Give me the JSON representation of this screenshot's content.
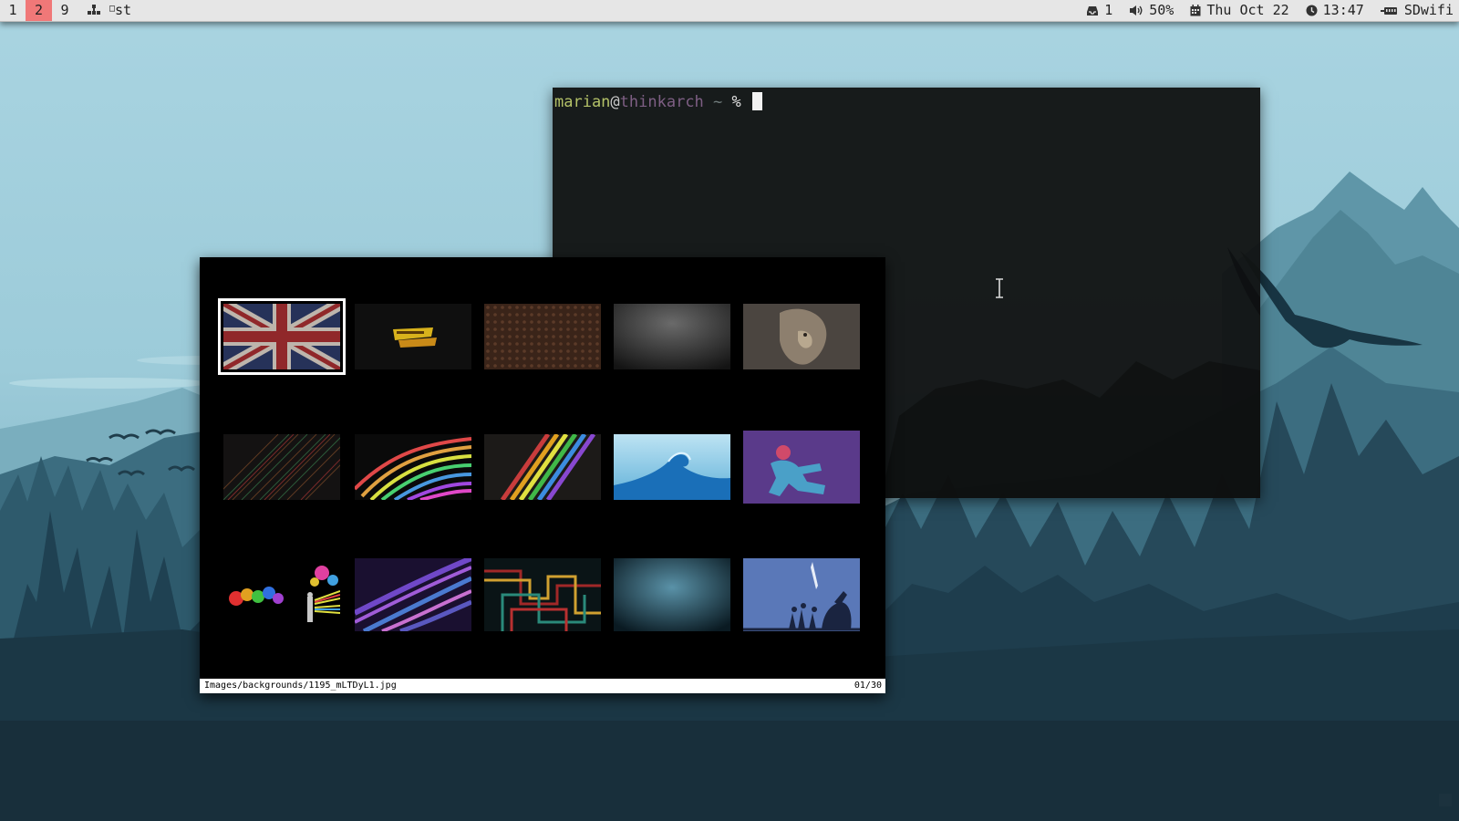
{
  "topbar": {
    "workspaces": [
      {
        "label": "1",
        "active": false
      },
      {
        "label": "2",
        "active": true
      },
      {
        "label": "9",
        "active": false
      }
    ],
    "active_color": "#f07878",
    "layout_icon": "layout-icon",
    "window_title": "st",
    "status": {
      "mail": {
        "icon": "inbox-icon",
        "value": "1"
      },
      "volume": {
        "icon": "speaker-icon",
        "value": "50%"
      },
      "date": {
        "icon": "calendar-icon",
        "value": "Thu Oct 22"
      },
      "time": {
        "icon": "clock-icon",
        "value": "13:47"
      },
      "network": {
        "icon": "ethernet-icon",
        "value": "SDwifi"
      }
    }
  },
  "terminal": {
    "user": "marian",
    "at": "@",
    "host": "thinkarch",
    "dir": " ~ ",
    "symbol": "% "
  },
  "viewer": {
    "path": "Images/backgrounds/1195_mLTDyL1.jpg",
    "counter": "01/30",
    "thumbnails": [
      {
        "name": "union-jack",
        "selected": true
      },
      {
        "name": "back-to-the-future",
        "selected": false
      },
      {
        "name": "brown-pattern",
        "selected": false
      },
      {
        "name": "gray-gradient",
        "selected": false
      },
      {
        "name": "lion",
        "selected": false
      },
      {
        "name": "dark-diagonal-lines",
        "selected": false
      },
      {
        "name": "rainbow-curves",
        "selected": false
      },
      {
        "name": "rainbow-stripes",
        "selected": false
      },
      {
        "name": "blue-water-wave",
        "selected": false
      },
      {
        "name": "purple-figure",
        "selected": false
      },
      {
        "name": "paint-splash",
        "selected": false
      },
      {
        "name": "purple-lines",
        "selected": false
      },
      {
        "name": "retro-pipes",
        "selected": false
      },
      {
        "name": "dark-blue-gradient",
        "selected": false
      },
      {
        "name": "blue-silhouettes",
        "selected": false
      }
    ]
  }
}
